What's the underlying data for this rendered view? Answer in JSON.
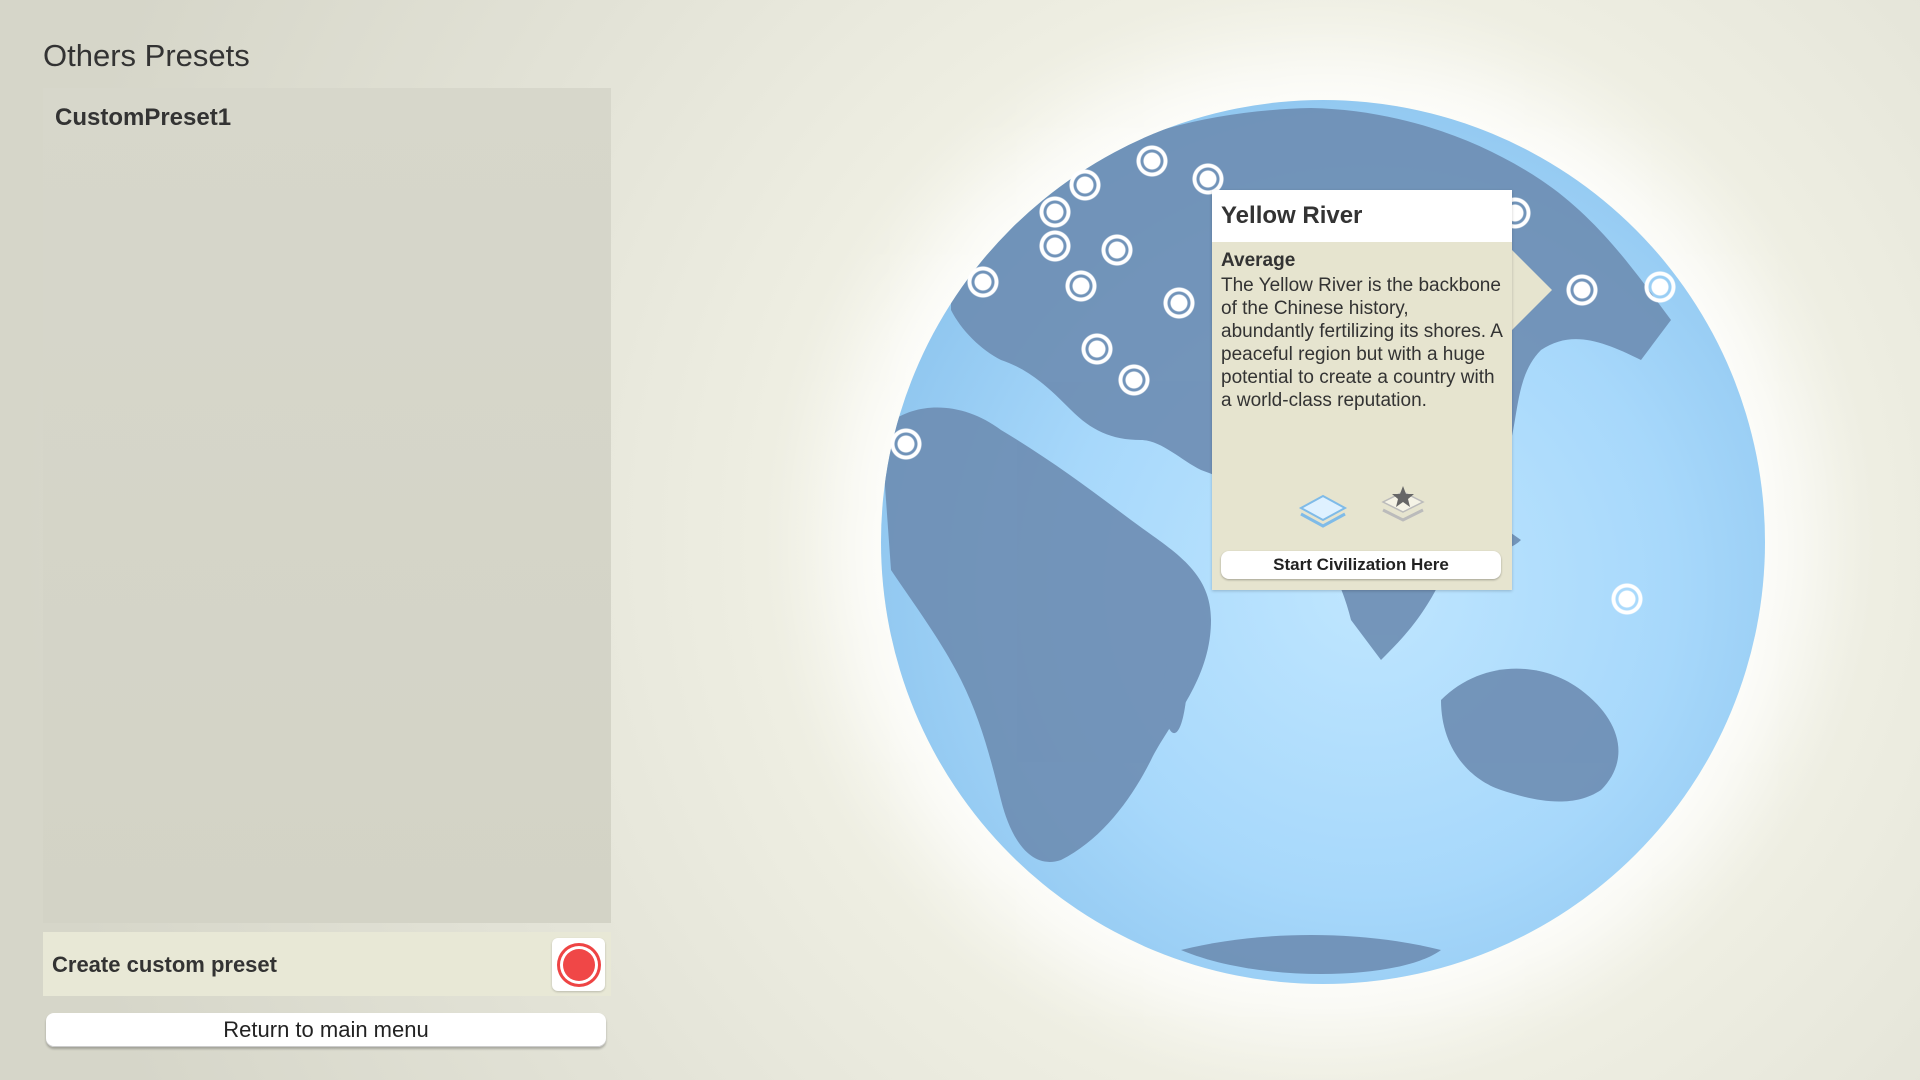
{
  "left_panel": {
    "title": "Others Presets",
    "presets": [
      "CustomPreset1"
    ],
    "create_label": "Create custom preset",
    "return_label": "Return to main menu"
  },
  "tooltip": {
    "title": "Yellow River",
    "difficulty": "Average",
    "description": "The Yellow River is the backbone of the Chinese history, abundantly fertilizing its shores. A peaceful region but with a huge potential to create a country with a world-class reputation.",
    "start_label": "Start Civilization Here",
    "icons": [
      "layers-icon",
      "star-layers-icon"
    ]
  },
  "colors": {
    "accent_record": "#f04747",
    "tooltip_bg": "#e6e4cf",
    "globe_ocean": "#a7d8fb",
    "globe_land": "#6f8fb3"
  }
}
